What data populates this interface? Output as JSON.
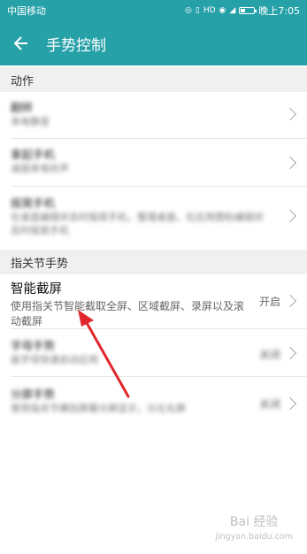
{
  "status_bar": {
    "carrier": "中国移动",
    "icons": [
      "hotspot-icon",
      "vibrate-icon",
      "hd-icon",
      "eye-icon",
      "signal-4g-icon",
      "battery-icon"
    ],
    "battery_level": 0.3,
    "time": "晚上7:05"
  },
  "app_bar": {
    "title": "手势控制",
    "background": "#26a1a8"
  },
  "sections": [
    {
      "header": "动作",
      "items": [
        {
          "title": "翻转",
          "desc": "来电静音"
        },
        {
          "title": "拿起手机",
          "desc": "减弱来电铃声"
        },
        {
          "title": "摇晃手机",
          "desc": "在桌面编辑状态时摇晃手机，整理桌面，在应用图标编辑状态时摇晃手机"
        }
      ]
    },
    {
      "header": "指关节手势",
      "items": [
        {
          "title": "智能截屏",
          "desc": "使用指关节智能截取全屏、区域截屏、录屏以及滚动截屏",
          "state": "开启"
        },
        {
          "title": "字母手势",
          "desc": "画字母快速启动应用",
          "state": "关闭"
        },
        {
          "title": "分屏手势",
          "desc": "使用指关节横划屏幕分屏显示，分左右屏",
          "state": "关闭"
        }
      ]
    }
  ],
  "annotation": {
    "arrow_color": "#e0262b"
  },
  "watermark": {
    "text": "Bai 经验",
    "sub": "jingyan.baidu.com"
  }
}
